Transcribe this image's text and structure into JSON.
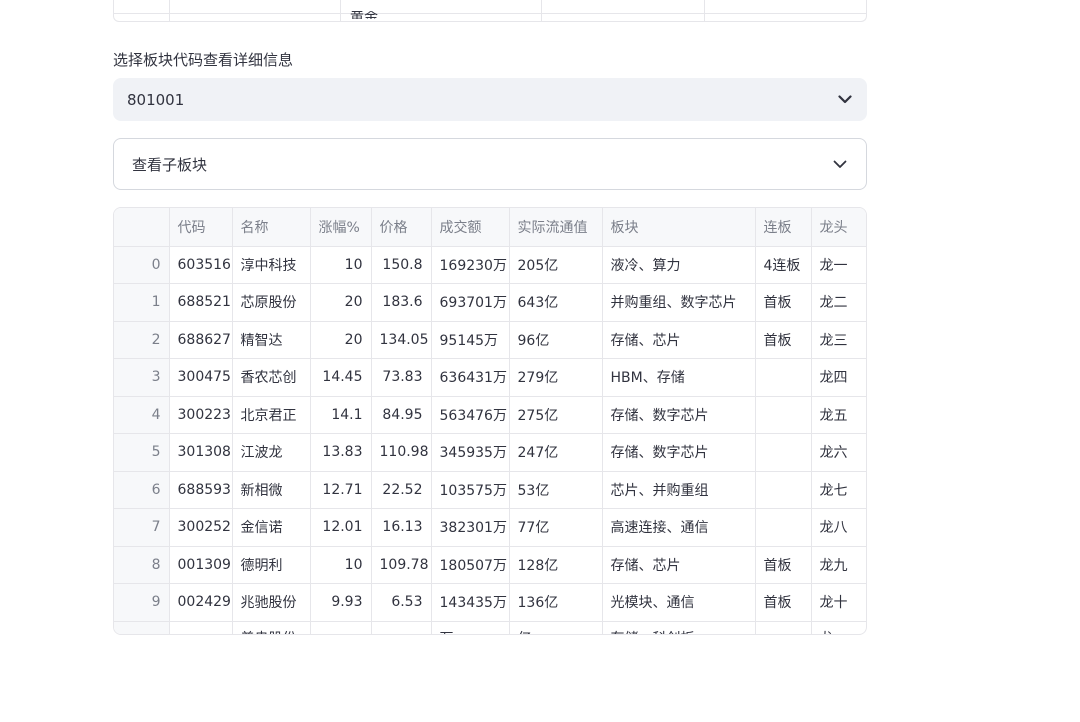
{
  "top_fragment": {
    "clipped_text": "黄金"
  },
  "select": {
    "label": "选择板块代码查看详细信息",
    "value": "801001"
  },
  "expander": {
    "label": "查看子板块"
  },
  "table": {
    "columns": [
      "",
      "代码",
      "名称",
      "涨幅%",
      "价格",
      "成交额",
      "实际流通值",
      "板块",
      "连板",
      "龙头"
    ],
    "rows": [
      {
        "i": "0",
        "code": "603516",
        "name": "淳中科技",
        "chg": "10",
        "price": "150.8",
        "vol": "169230万",
        "cap": "205亿",
        "sector": "液冷、算力",
        "lb": "4连板",
        "lt": "龙一"
      },
      {
        "i": "1",
        "code": "688521",
        "name": "芯原股份",
        "chg": "20",
        "price": "183.6",
        "vol": "693701万",
        "cap": "643亿",
        "sector": "并购重组、数字芯片",
        "lb": "首板",
        "lt": "龙二"
      },
      {
        "i": "2",
        "code": "688627",
        "name": "精智达",
        "chg": "20",
        "price": "134.05",
        "vol": "95145万",
        "cap": "96亿",
        "sector": "存储、芯片",
        "lb": "首板",
        "lt": "龙三"
      },
      {
        "i": "3",
        "code": "300475",
        "name": "香农芯创",
        "chg": "14.45",
        "price": "73.83",
        "vol": "636431万",
        "cap": "279亿",
        "sector": "HBM、存储",
        "lb": "",
        "lt": "龙四"
      },
      {
        "i": "4",
        "code": "300223",
        "name": "北京君正",
        "chg": "14.1",
        "price": "84.95",
        "vol": "563476万",
        "cap": "275亿",
        "sector": "存储、数字芯片",
        "lb": "",
        "lt": "龙五"
      },
      {
        "i": "5",
        "code": "301308",
        "name": "江波龙",
        "chg": "13.83",
        "price": "110.98",
        "vol": "345935万",
        "cap": "247亿",
        "sector": "存储、数字芯片",
        "lb": "",
        "lt": "龙六"
      },
      {
        "i": "6",
        "code": "688593",
        "name": "新相微",
        "chg": "12.71",
        "price": "22.52",
        "vol": "103575万",
        "cap": "53亿",
        "sector": "芯片、并购重组",
        "lb": "",
        "lt": "龙七"
      },
      {
        "i": "7",
        "code": "300252",
        "name": "金信诺",
        "chg": "12.01",
        "price": "16.13",
        "vol": "382301万",
        "cap": "77亿",
        "sector": "高速连接、通信",
        "lb": "",
        "lt": "龙八"
      },
      {
        "i": "8",
        "code": "001309",
        "name": "德明利",
        "chg": "10",
        "price": "109.78",
        "vol": "180507万",
        "cap": "128亿",
        "sector": "存储、芯片",
        "lb": "首板",
        "lt": "龙九"
      },
      {
        "i": "9",
        "code": "002429",
        "name": "兆驰股份",
        "chg": "9.93",
        "price": "6.53",
        "vol": "143435万",
        "cap": "136亿",
        "sector": "光模块、通信",
        "lb": "首板",
        "lt": "龙十"
      }
    ],
    "partial_row": {
      "name": "普冉股份",
      "vol": "万",
      "cap": "亿",
      "sector": "存储、科创板",
      "lt": "龙"
    }
  }
}
